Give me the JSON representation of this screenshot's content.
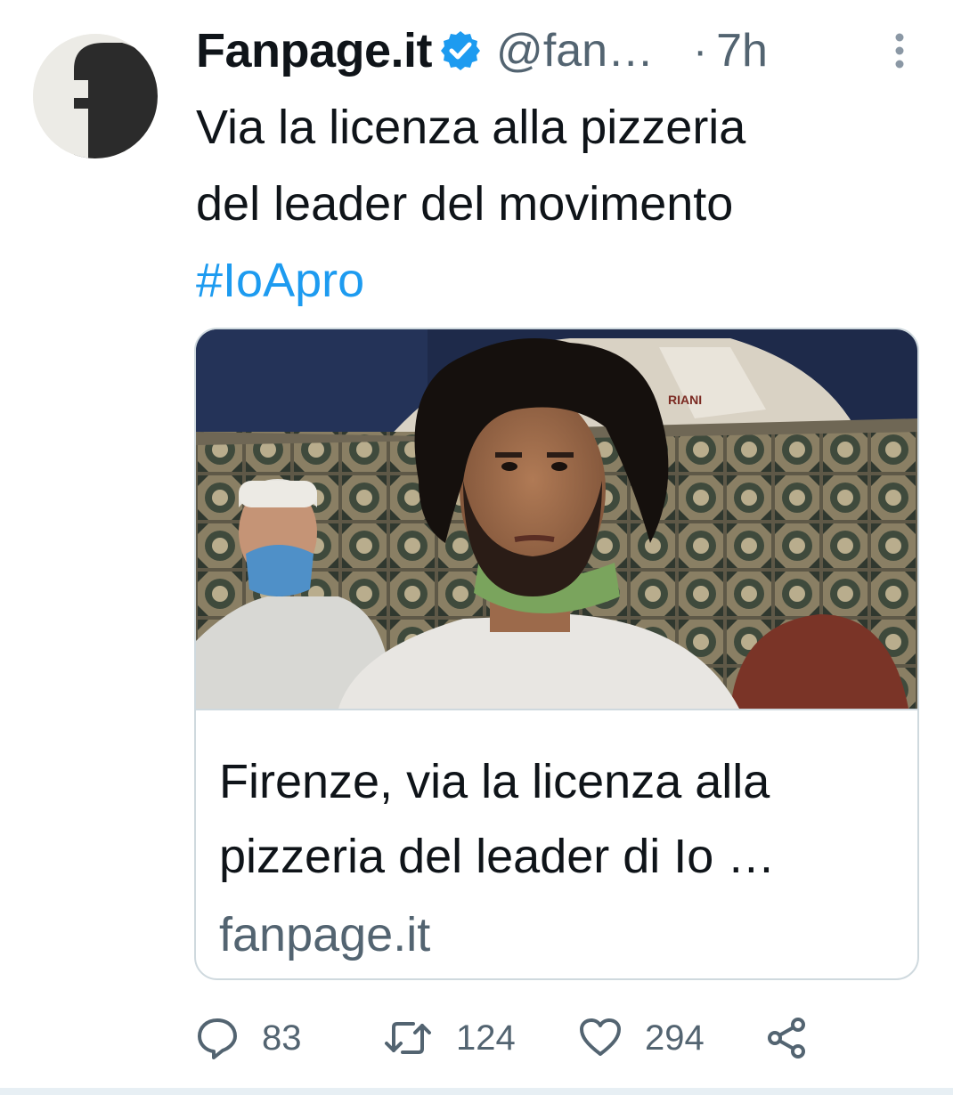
{
  "tweet": {
    "display_name": "Fanpage.it",
    "handle": "@fan…",
    "separator": "·",
    "time": "7h",
    "text_line1": "Via la licenza alla pizzeria",
    "text_line2": "del leader del movimento",
    "hashtag": "#IoApro",
    "avatar_icon": "fanpage-logo",
    "verified_icon": "verified-badge-icon",
    "more_icon": "more-vertical-icon"
  },
  "card": {
    "title_line1": "Firenze, via la licenza alla",
    "title_line2": "pizzeria del leader di Io …",
    "domain": "fanpage.it",
    "image_sign_text": "RIANI"
  },
  "actions": {
    "replies": "83",
    "retweets": "124",
    "likes": "294",
    "reply_icon": "reply-icon",
    "retweet_icon": "retweet-icon",
    "like_icon": "heart-icon",
    "share_icon": "share-icon"
  },
  "colors": {
    "text": "#0f1419",
    "secondary": "#536471",
    "accent": "#1d9bf0",
    "border": "#cfd9de"
  }
}
